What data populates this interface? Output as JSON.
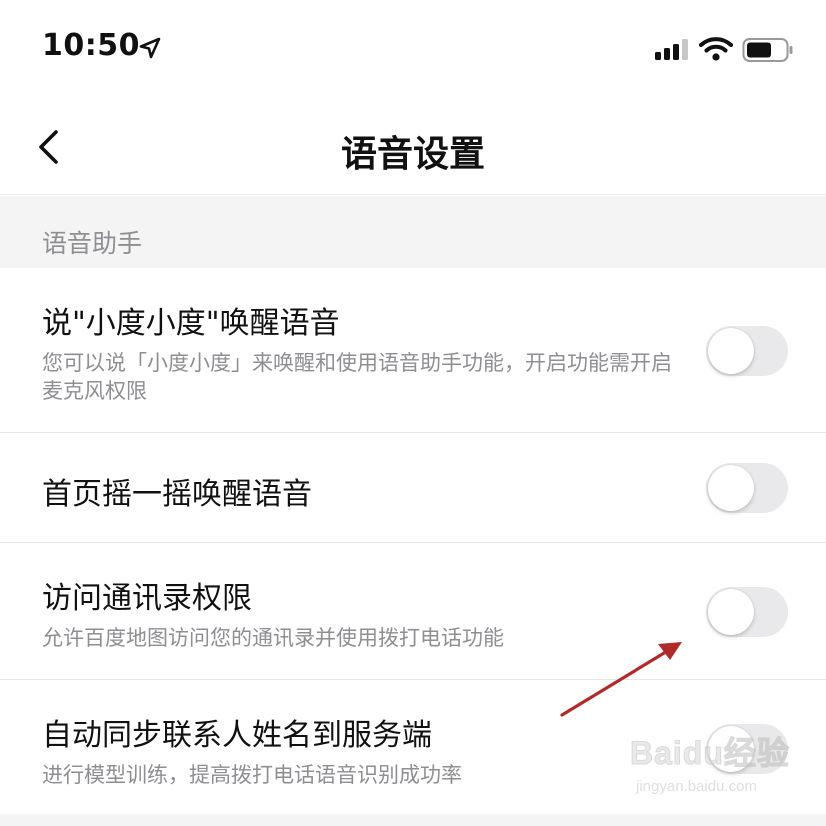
{
  "status_bar": {
    "time": "10:50"
  },
  "nav": {
    "title": "语音设置"
  },
  "section": {
    "title": "语音助手"
  },
  "settings": [
    {
      "title": "说\"小度小度\"唤醒语音",
      "description": "您可以说「小度小度」来唤醒和使用语音助手功能，开启功能需开启麦克风权限",
      "enabled": false
    },
    {
      "title": "首页摇一摇唤醒语音",
      "description": "",
      "enabled": false
    },
    {
      "title": "访问通讯录权限",
      "description": "允许百度地图访问您的通讯录并使用拨打电话功能",
      "enabled": false
    },
    {
      "title": "自动同步联系人姓名到服务端",
      "description": "进行模型训练，提高拨打电话语音识别成功率",
      "enabled": false
    }
  ],
  "watermark": {
    "text": "Baidu经验",
    "sub": "jingyan.baidu.com"
  },
  "colors": {
    "toggle_off": "#e9e9eb",
    "section_bg": "#f4f4f5",
    "arrow": "#b02a2a"
  }
}
